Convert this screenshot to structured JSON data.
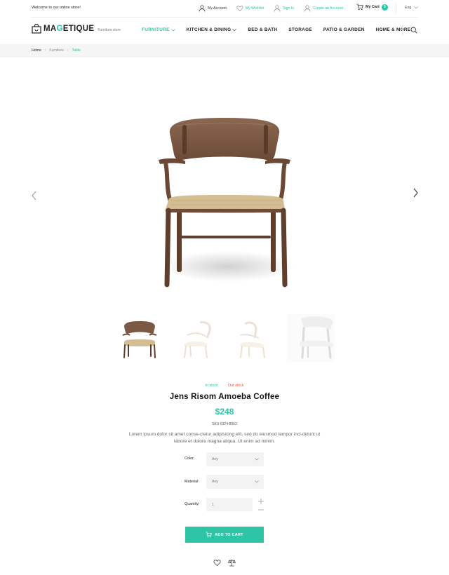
{
  "topbar": {
    "welcome": "Welcome to our online store!",
    "links": [
      {
        "label": "My Account",
        "icon": "user-icon"
      },
      {
        "label": "My Wishlist",
        "icon": "heart-icon"
      },
      {
        "label": "Sign In",
        "icon": "user-icon"
      },
      {
        "label": "Create an Account",
        "icon": "user-add-icon"
      }
    ],
    "cart_label": "My Cart",
    "cart_count": "0",
    "language": "Eng"
  },
  "header": {
    "logo_prefix": "MA",
    "logo_accent": "G",
    "logo_suffix": "ETIQUE",
    "tagline": "Furniture store",
    "nav": [
      {
        "label": "FURNITURE"
      },
      {
        "label": "KITCHEN & DINING"
      },
      {
        "label": "BED & BATH"
      },
      {
        "label": "STORAGE"
      },
      {
        "label": "PATIO & GARDEN"
      },
      {
        "label": "HOME & MORE"
      }
    ]
  },
  "breadcrumb": [
    "Home",
    "Furniture",
    "Table"
  ],
  "product": {
    "in_stock": "In stock",
    "out_stock": "Out stock",
    "title": "Jens Risom Amoeba Coffee",
    "price": "$248",
    "sku": "SKU 6324-8563",
    "description": "Lorem ipsum dolor sit amet conse-ctetur adipisicing elit, sed do eiusmod tempor inci-didunt ut labore et dolore magna aliqua. Ut enim ad minim.",
    "color_label": "Color:",
    "color_value": "Any",
    "material_label": "Material:",
    "material_value": "Any",
    "quantity_label": "Quantity:",
    "quantity_value": "1",
    "add_to_cart": "ADD TO CART"
  },
  "colors": {
    "accent": "#2ec4a6",
    "out_of_stock": "#e5533d",
    "wood": "#7a5a45",
    "seat": "#d8c39a"
  }
}
